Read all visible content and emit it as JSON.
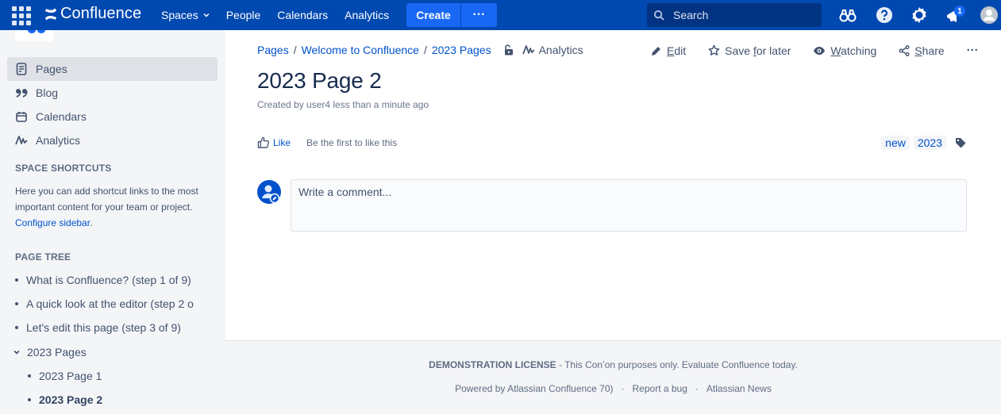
{
  "topnav": {
    "app_name": "Confluence",
    "links": [
      {
        "label": "Spaces",
        "has_dropdown": true
      },
      {
        "label": "People"
      },
      {
        "label": "Calendars"
      },
      {
        "label": "Analytics"
      }
    ],
    "create_label": "Create",
    "more_label": "···",
    "search_placeholder": "Search",
    "notification_count": "1",
    "icons": [
      "app-switcher-icon",
      "binoculars-icon",
      "help-icon",
      "settings-icon",
      "notifications-icon",
      "user-avatar-icon"
    ],
    "colors": {
      "bar": "#0049b0",
      "create": "#1868f5",
      "search_bg": "#023382"
    }
  },
  "sidebar": {
    "nav": [
      {
        "label": "Pages",
        "icon": "page-icon",
        "active": true
      },
      {
        "label": "Blog",
        "icon": "quote-icon"
      },
      {
        "label": "Calendars",
        "icon": "calendar-icon"
      },
      {
        "label": "Analytics",
        "icon": "analytics-icon"
      }
    ],
    "shortcuts_heading": "SPACE SHORTCUTS",
    "shortcuts_desc": "Here you can add shortcut links to the most important content for your team or project. ",
    "configure_link": "Configure sidebar",
    "configure_suffix": ".",
    "tree_heading": "PAGE TREE",
    "tree": [
      {
        "label": "What is Confluence? (step 1 of 9)",
        "level": 0
      },
      {
        "label": "A quick look at the editor (step 2 o",
        "level": 0
      },
      {
        "label": "Let's edit this page (step 3 of 9)",
        "level": 0
      },
      {
        "label": "2023 Pages",
        "level": 0,
        "expanded": true
      },
      {
        "label": "2023 Page 1",
        "level": 1
      },
      {
        "label": "2023 Page 2",
        "level": 1,
        "current": true
      }
    ]
  },
  "main": {
    "breadcrumb": [
      "Pages",
      "Welcome to Confluence",
      "2023 Pages"
    ],
    "breadcrumb_sep": "/",
    "analytics_label": "Analytics",
    "actions": {
      "edit": {
        "pre": "",
        "u": "E",
        "post": "dit"
      },
      "save": {
        "pre": "Save ",
        "u": "f",
        "post": "or later"
      },
      "watching": {
        "pre": "",
        "u": "W",
        "post": "atching"
      },
      "share": {
        "pre": "",
        "u": "S",
        "post": "hare"
      },
      "more": "···"
    },
    "title": "2023 Page 2",
    "byline": "Created by user4 less than a minute ago",
    "like_label": "Like",
    "like_text": "Be the first to like this",
    "labels": [
      "new",
      "2023"
    ],
    "comment_placeholder": "Write a comment..."
  },
  "footer": {
    "license_bold": "DEMONSTRATION LICENSE",
    "license_text": " - This Con’on purposes only. Evaluate Confluence today.",
    "powered_by": "Powered by Atlassian Confluence 70)",
    "report_bug": "Report a bug",
    "news": "Atlassian News",
    "dot": "·"
  }
}
